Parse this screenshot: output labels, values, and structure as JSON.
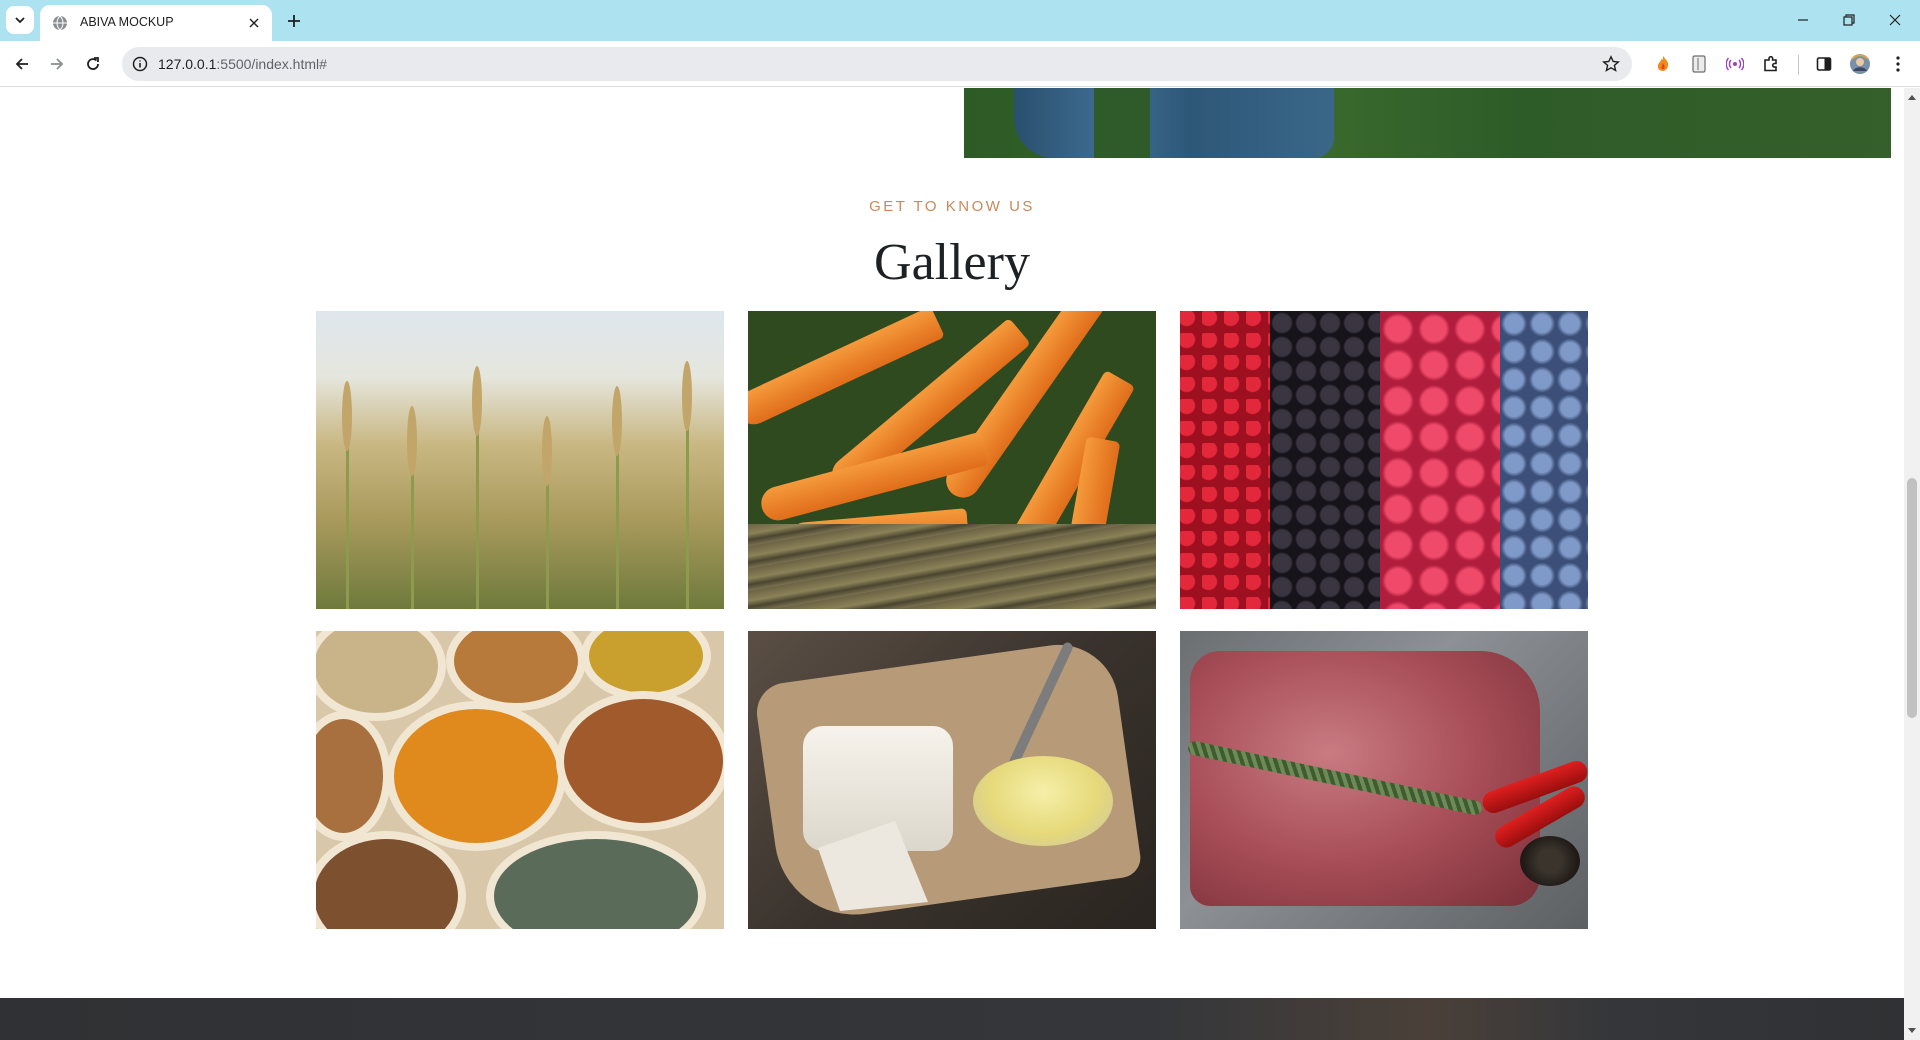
{
  "browser": {
    "tab_title": "ABIVA MOCKUP",
    "url_host": "127.0.0.1",
    "url_rest": ":5500/index.html#",
    "accent_color": "#ade3f0"
  },
  "section": {
    "eyebrow": "GET TO KNOW US",
    "heading": "Gallery",
    "eyebrow_color": "#c9895c"
  },
  "gallery": {
    "items": [
      {
        "name": "wheat"
      },
      {
        "name": "carrots"
      },
      {
        "name": "berries"
      },
      {
        "name": "spices"
      },
      {
        "name": "cheese"
      },
      {
        "name": "meat"
      }
    ]
  },
  "icons": {
    "tab_list": "chevron-down-icon",
    "favicon": "globe-icon",
    "close_tab": "close-icon",
    "new_tab": "plus-icon",
    "minimize": "minimize-icon",
    "restore": "restore-icon",
    "close_window": "close-icon",
    "back": "arrow-left-icon",
    "forward": "arrow-right-icon",
    "reload": "reload-icon",
    "site_info": "info-icon",
    "bookmark": "star-icon",
    "extensions": "puzzle-icon",
    "side_panel": "side-panel-icon",
    "profile": "avatar-icon",
    "menu": "kebab-menu-icon"
  }
}
